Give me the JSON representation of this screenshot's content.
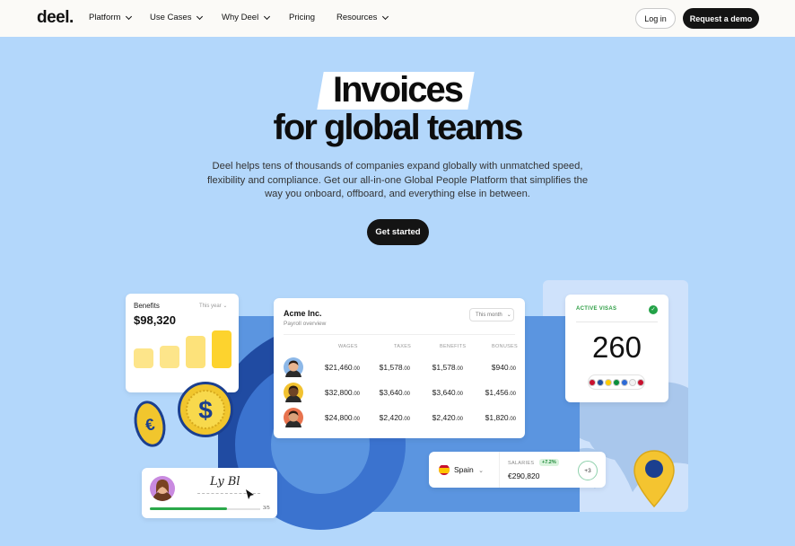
{
  "nav": {
    "logo": "deel.",
    "items": [
      {
        "label": "Platform",
        "has_dropdown": true
      },
      {
        "label": "Use Cases",
        "has_dropdown": true
      },
      {
        "label": "Why Deel",
        "has_dropdown": true
      },
      {
        "label": "Pricing",
        "has_dropdown": false
      },
      {
        "label": "Resources",
        "has_dropdown": true
      }
    ],
    "login": "Log in",
    "demo": "Request a demo"
  },
  "hero": {
    "title_highlight": "Invoices",
    "title_rest": "for global teams",
    "subtitle": "Deel helps tens of thousands of companies expand globally with unmatched speed, flexibility and compliance. Get our all-in-one Global People Platform that simplifies the way you onboard, offboard, and everything else in between.",
    "cta": "Get started"
  },
  "benefits_card": {
    "title": "Benefits",
    "period": "This year",
    "value": "$98,320",
    "bars": [
      0.3,
      0.35,
      0.5,
      0.58
    ],
    "bar_colors": [
      "#fde58a",
      "#fde58a",
      "#fde27a",
      "#fdd32e"
    ]
  },
  "acme_card": {
    "title": "Acme Inc.",
    "subtitle": "Payroll overview",
    "period": "This month",
    "columns": [
      "WAGES",
      "TAXES",
      "BENEFITS",
      "BONUSES"
    ],
    "rows": [
      {
        "wages": "$21,460",
        "taxes": "$1,578",
        "benefits": "$1,578",
        "bonuses": "$940",
        "avatar_bg": "#8db8e8",
        "skin": "#e8b48f"
      },
      {
        "wages": "$32,800",
        "taxes": "$3,640",
        "benefits": "$3,640",
        "bonuses": "$1,456",
        "avatar_bg": "#f2c230",
        "skin": "#6e4426"
      },
      {
        "wages": "$24,800",
        "taxes": "$2,420",
        "benefits": "$2,420",
        "bonuses": "$1,820",
        "avatar_bg": "#e8734e",
        "skin": "#d9a27b"
      }
    ],
    "cents": ".00"
  },
  "visas_card": {
    "label": "ACTIVE VISAS",
    "count": "260",
    "flag_colors": [
      "#c8102e",
      "#1f4fa0",
      "#ffcc00",
      "#0a8f3c",
      "#2d6ad6",
      "#f2f2f2",
      "#c8102e"
    ]
  },
  "signature_card": {
    "signature": "Ly Bl",
    "progress": 0.7,
    "count": "3/5"
  },
  "spain_card": {
    "country": "Spain",
    "salaries_label": "SALARIES",
    "change": "+7.2%",
    "value": "€290,820",
    "more": "+3"
  },
  "colors": {
    "hero_bg": "#b3d7fb",
    "dark": "#141414",
    "green": "#23a247",
    "navy": "#204ba2"
  },
  "icons": [
    "chevron-down-icon",
    "dollar-coin-icon",
    "euro-coin-icon",
    "location-pin-icon",
    "check-icon",
    "cursor-icon",
    "world-map-icon"
  ]
}
